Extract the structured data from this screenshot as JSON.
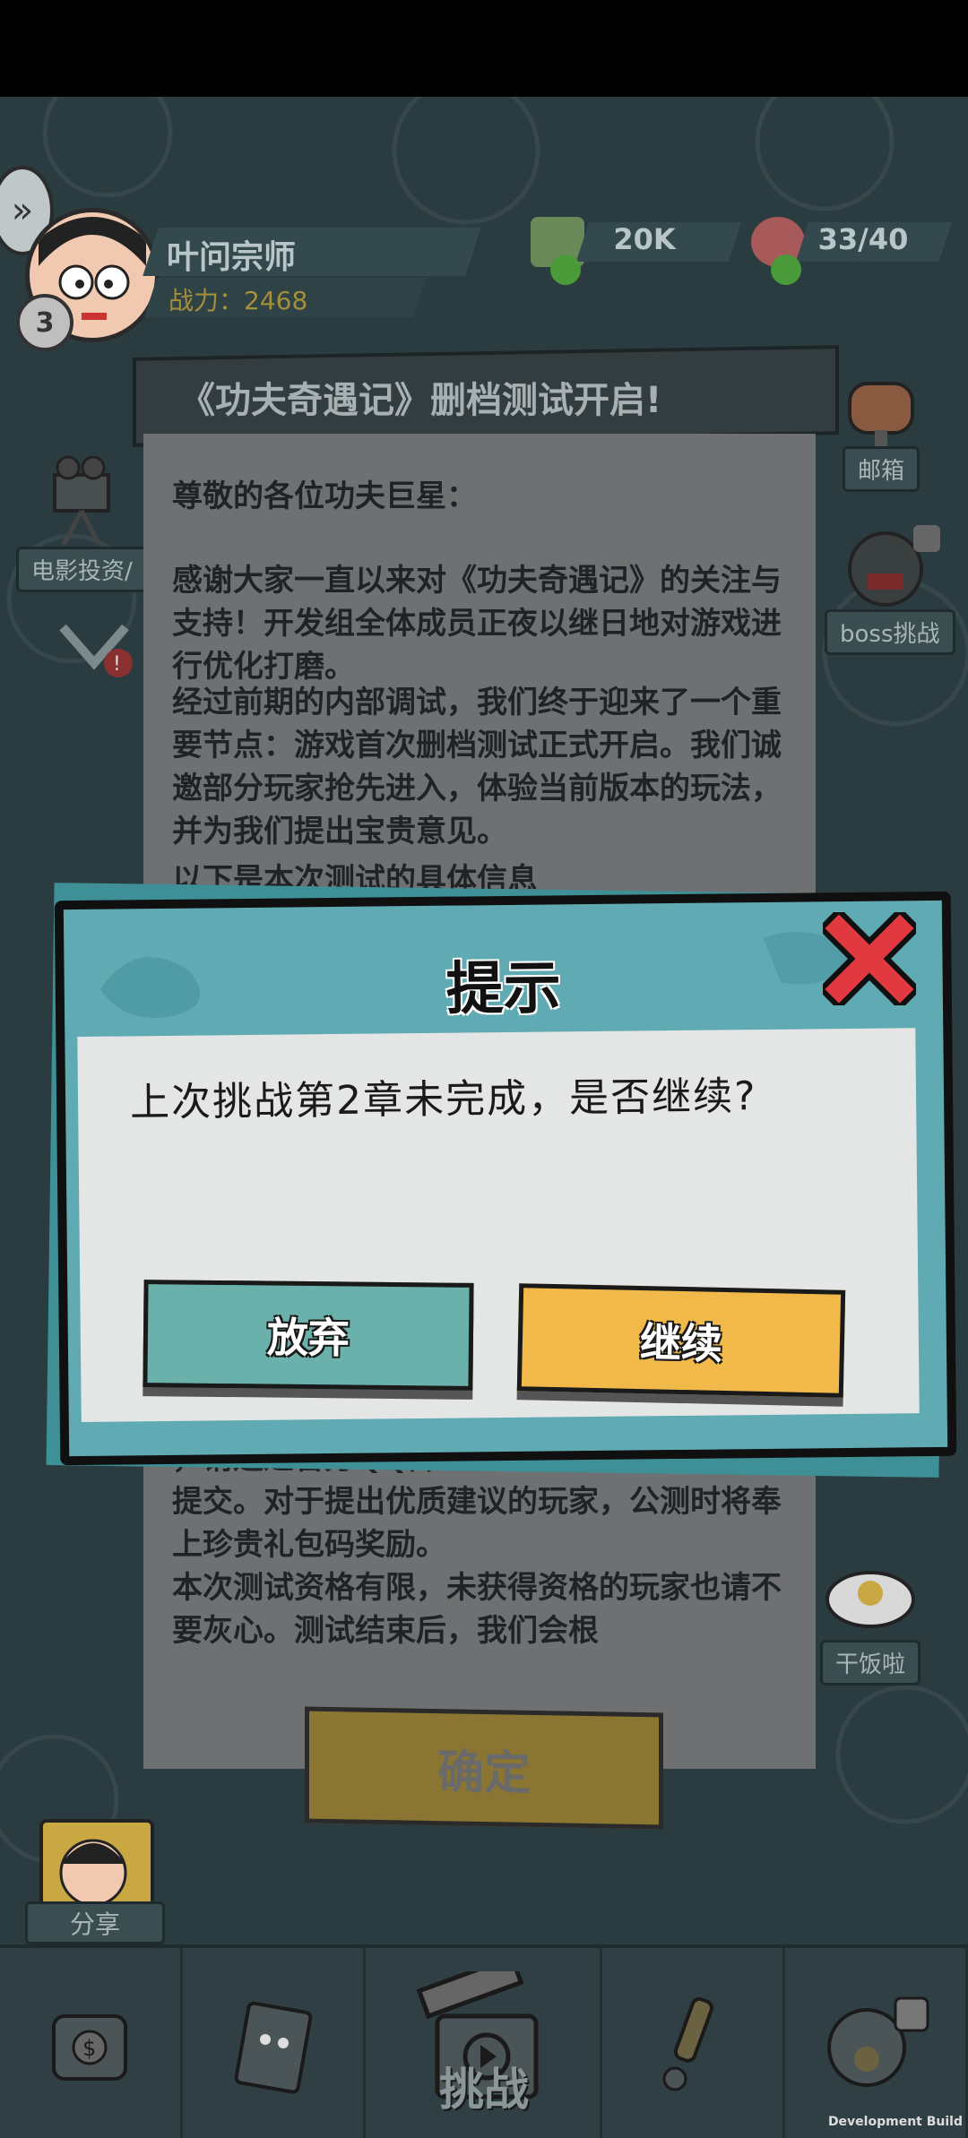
{
  "header": {
    "player_name": "叶问宗师",
    "power": "战力：2468",
    "level": "3",
    "currency_amount": "20K",
    "energy": "33/40"
  },
  "side_buttons": {
    "mailbox": "邮箱",
    "movie_invest": "电影投资/",
    "boss_challenge": "boss挑战",
    "rice": "干饭啦",
    "share": "分享"
  },
  "notice": {
    "title": "《功夫奇遇记》删档测试开启!",
    "greeting": "尊敬的各位功夫巨星：",
    "paragraph1": "感谢大家一直以来对《功夫奇遇记》的关注与支持！开发组全体成员正夜以继日地对游戏进行优化打磨。",
    "paragraph2": "经过前期的内部调试，我们终于迎来了一个重要节点：游戏首次删档测试正式开启。我们诚邀部分玩家抢先进入，体验当前版本的玩法，并为我们提出宝贵意见。",
    "partial_line": "以下是本次测试的具体信息",
    "partial_contact": "，请通过官方QQ群：    1027435591",
    "paragraph3": "提交。对于提出优质建议的玩家，公测时将奉上珍贵礼包码奖励。",
    "paragraph4": "本次测试资格有限，未获得资格的玩家也请不要灰心。测试结束后，我们会根",
    "confirm": "确定"
  },
  "dialog": {
    "title": "提示",
    "message": "上次挑战第2章未完成，是否继续?",
    "abandon": "放弃",
    "continue": "继续"
  },
  "bottom_nav": {
    "challenge": "挑战"
  },
  "footer": {
    "dev_build": "Development Build"
  }
}
